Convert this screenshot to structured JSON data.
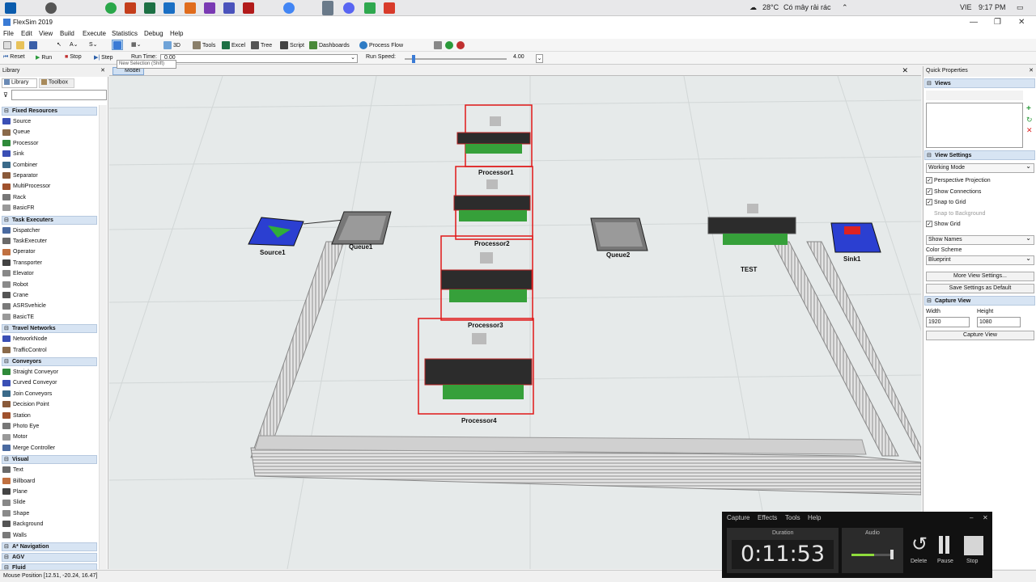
{
  "taskbar": {
    "weather_temp": "28°C",
    "weather_text": "Có mây rải rác",
    "language": "VIE",
    "time": "9:17 PM"
  },
  "window": {
    "title": "FlexSim 2019"
  },
  "menubar": [
    "File",
    "Edit",
    "View",
    "Build",
    "Execute",
    "Statistics",
    "Debug",
    "Help"
  ],
  "toolbar1": {
    "btn_3d": "3D",
    "tools": "Tools",
    "excel": "Excel",
    "tree": "Tree",
    "script": "Script",
    "dashboards": "Dashboards",
    "process_flow": "Process Flow",
    "tooltip": "New Selection (Shift)"
  },
  "toolbar2": {
    "reset": "Reset",
    "run": "Run",
    "stop": "Stop",
    "step": "Step",
    "run_time_label": "Run Time:",
    "run_time_value": "0.00",
    "run_speed_label": "Run Speed:",
    "run_speed_value": "4.00",
    "run_speed_fraction": 0.02
  },
  "library": {
    "title": "Library",
    "tabs": [
      "Library",
      "Toolbox"
    ],
    "categories": [
      {
        "name": "Fixed Resources",
        "items": [
          "Source",
          "Queue",
          "Processor",
          "Sink",
          "Combiner",
          "Separator",
          "MultiProcessor",
          "Rack",
          "BasicFR"
        ]
      },
      {
        "name": "Task Executers",
        "items": [
          "Dispatcher",
          "TaskExecuter",
          "Operator",
          "Transporter",
          "Elevator",
          "Robot",
          "Crane",
          "ASRSvehicle",
          "BasicTE"
        ]
      },
      {
        "name": "Travel Networks",
        "items": [
          "NetworkNode",
          "TrafficControl"
        ]
      },
      {
        "name": "Conveyors",
        "items": [
          "Straight Conveyor",
          "Curved Conveyor",
          "Join Conveyors",
          "Decision Point",
          "Station",
          "Photo Eye",
          "Motor",
          "Merge Controller"
        ]
      },
      {
        "name": "Visual",
        "items": [
          "Text",
          "Billboard",
          "Plane",
          "Slide",
          "Shape",
          "Background",
          "Walls"
        ]
      },
      {
        "name": "A* Navigation",
        "items": []
      },
      {
        "name": "AGV",
        "items": []
      },
      {
        "name": "Fluid",
        "items": []
      }
    ]
  },
  "model": {
    "tab": "Model",
    "objects": {
      "source": "Source1",
      "queue1": "Queue1",
      "queue2": "Queue2",
      "p1": "Processor1",
      "p2": "Processor2",
      "p3": "Processor3",
      "p4": "Processor4",
      "test": "TEST",
      "sink": "Sink1"
    }
  },
  "quick_properties": {
    "title": "Quick Properties",
    "views": "Views",
    "view_settings": "View Settings",
    "working_mode": "Working Mode",
    "checks": [
      {
        "label": "Perspective Projection",
        "checked": true
      },
      {
        "label": "Show Connections",
        "checked": true
      },
      {
        "label": "Snap to Grid",
        "checked": true
      },
      {
        "label": "Snap to Background",
        "checked": false
      },
      {
        "label": "Show Grid",
        "checked": true
      }
    ],
    "show_names": "Show Names",
    "color_scheme_label": "Color Scheme",
    "color_scheme": "Blueprint",
    "more_view_settings": "More View Settings...",
    "save_default": "Save Settings as Default",
    "capture_view": "Capture View",
    "width_label": "Width",
    "height_label": "Height",
    "width": "1920",
    "height": "1080",
    "capture_btn": "Capture View"
  },
  "status": {
    "mouse_position": "Mouse Position [12.51, -20.24, 16.47]"
  },
  "capture_overlay": {
    "menu": [
      "Capture",
      "Effects",
      "Tools",
      "Help"
    ],
    "duration_label": "Duration",
    "audio_label": "Audio",
    "duration": "0:11:53",
    "delete": "Delete",
    "pause": "Pause",
    "stop": "Stop"
  }
}
